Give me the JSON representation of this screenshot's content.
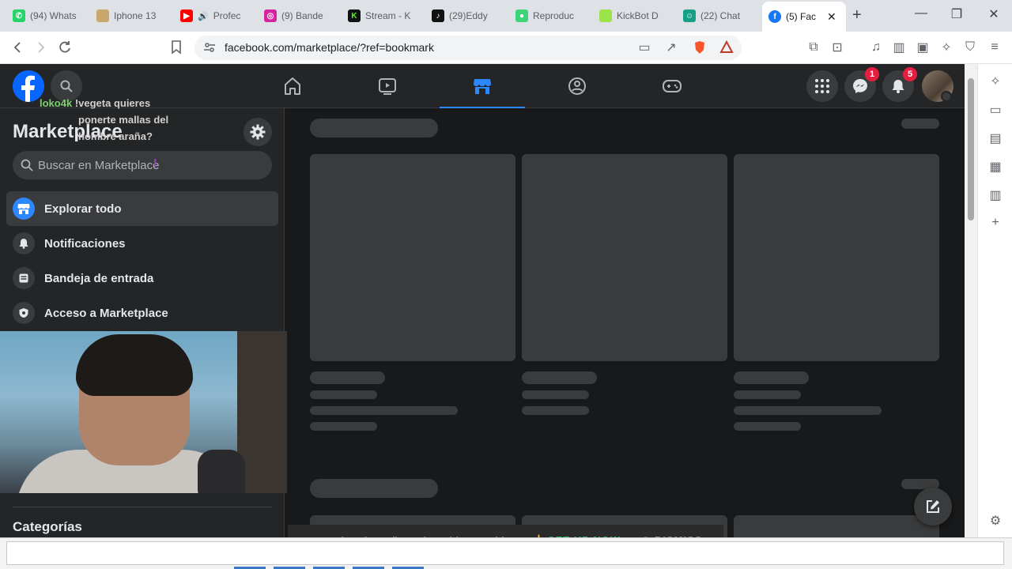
{
  "browser": {
    "tabs": [
      {
        "label": "(94) Whats",
        "icon": "whatsapp-icon",
        "color": "#25d366"
      },
      {
        "label": "Iphone 13",
        "icon": "page-icon",
        "color": "#c7a86a"
      },
      {
        "label": "Profec",
        "icon": "youtube-icon",
        "color": "#ff0000"
      },
      {
        "label": "(9) Bande",
        "icon": "instagram-icon",
        "color": "#d6249f"
      },
      {
        "label": "Stream - K",
        "icon": "kick-icon",
        "color": "#53fc18"
      },
      {
        "label": "(29)Eddy",
        "icon": "tiktok-icon",
        "color": "#111111"
      },
      {
        "label": "Reproduc",
        "icon": "chat-app-icon",
        "color": "#3ed47a"
      },
      {
        "label": "KickBot D",
        "icon": "kickbot-icon",
        "color": "#9be34a"
      },
      {
        "label": "(22) Chat",
        "icon": "bot-icon",
        "color": "#16a085"
      },
      {
        "label": "(5) Fac",
        "icon": "facebook-icon",
        "color": "#1877f2"
      }
    ],
    "url": "facebook.com/marketplace/?ref=bookmark"
  },
  "nav": {
    "messenger_badge": "1",
    "notifications_badge": "5"
  },
  "sidebar": {
    "title": "Marketplace",
    "search_placeholder": "Buscar en Marketplace",
    "items": [
      {
        "label": "Explorar todo"
      },
      {
        "label": "Notificaciones"
      },
      {
        "label": "Bandeja de entrada"
      },
      {
        "label": "Acceso a Marketplace"
      }
    ],
    "categories_label": "Categorías"
  },
  "overlay": {
    "chat_user": "loko4k",
    "chat_message_1": "!vegeta quieres",
    "chat_message_2": "ponerte mallas del",
    "chat_message_3": "hombre araña?",
    "toast_text": "Detected a misconfiguration with VB Cable",
    "toast_setup": "SET-UP NOW",
    "toast_dismiss": "DISMISS"
  },
  "colors": {
    "accent": "#2d88ff",
    "fb_blue": "#0866ff",
    "badge": "#e41e3f"
  }
}
